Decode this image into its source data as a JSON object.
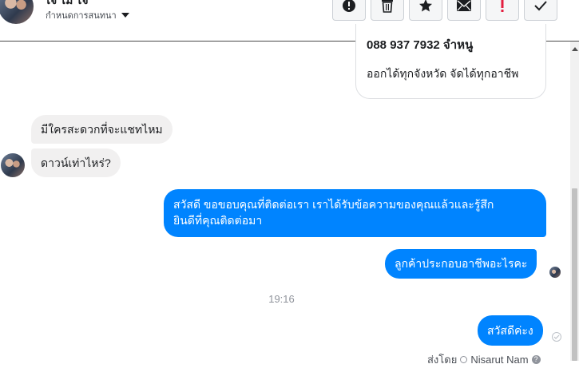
{
  "header": {
    "contact_name_partial": "ไจ ไม่ ไจ",
    "conversation_settings": "กำหนดการสนทนา",
    "actions": [
      {
        "name": "report-button",
        "icon": "alert-circle-icon"
      },
      {
        "name": "delete-button",
        "icon": "trash-icon"
      },
      {
        "name": "star-button",
        "icon": "star-icon"
      },
      {
        "name": "mark-unread-button",
        "icon": "envelope-icon"
      },
      {
        "name": "spam-button",
        "icon": "exclamation-icon"
      },
      {
        "name": "mark-done-button",
        "icon": "check-icon"
      }
    ]
  },
  "card": {
    "phone_partial": "088 937 7932 จำหนู",
    "text": "ออกได้ทุกจังหวัด จัดได้ทุกอาชีพ"
  },
  "messages": {
    "in_1": "มีใครสะดวกที่จะแชทไหม",
    "in_2": "ดาวน์เท่าไหร่?",
    "out_1_line1": "สวัสดี ขอขอบคุณที่ติดต่อเรา เราได้รับข้อความของคุณแล้วและรู้สึก",
    "out_1_line2": "ยินดีที่คุณติดต่อมา",
    "out_2": "ลูกค้าประกอบอาชีพอะไรคะ",
    "timestamp": "19:16",
    "out_3": "สวัสดีค่ะง"
  },
  "footer": {
    "sent_by_label": "ส่งโดย",
    "sender_name": "Nisarut Nam",
    "help_glyph": "?"
  },
  "colors": {
    "outgoing_bubble": "#0084ff",
    "incoming_bubble": "#f1f0f0",
    "spam_icon": "#e41e3f"
  }
}
